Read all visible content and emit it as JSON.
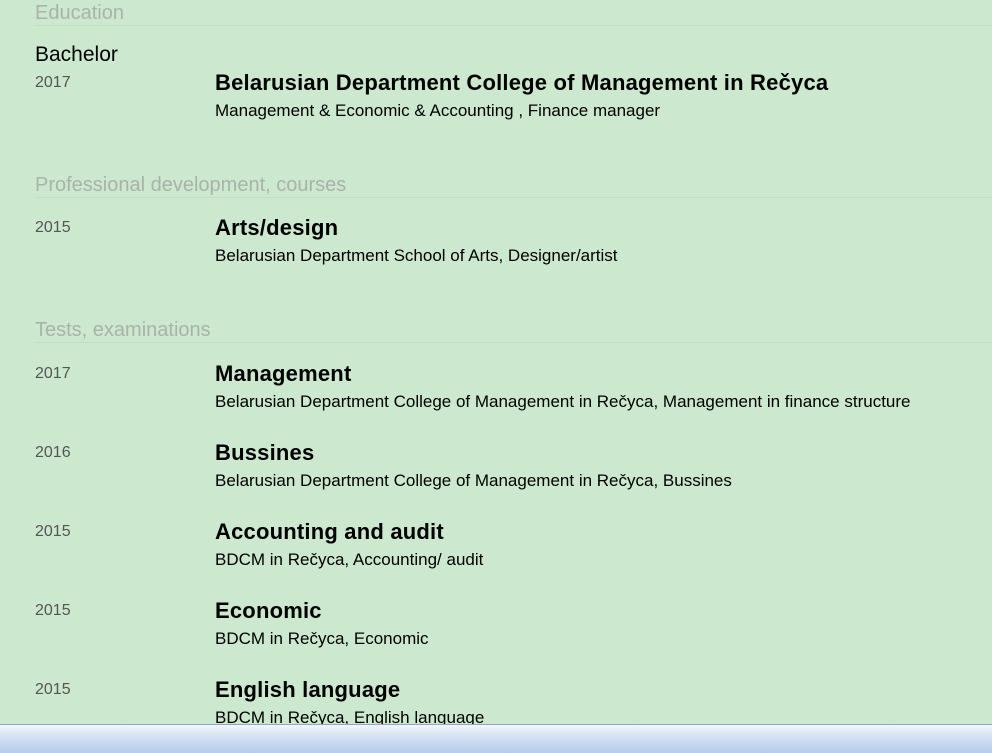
{
  "education": {
    "title": "Education",
    "degree": "Bachelor",
    "entries": [
      {
        "year": "2017",
        "title": "Belarusian Department College of Management in Rečyca",
        "desc": "Management & Economic & Accounting , Finance manager"
      }
    ]
  },
  "courses": {
    "title": "Professional development, courses",
    "entries": [
      {
        "year": "2015",
        "title": "Arts/design",
        "desc": "Belarusian Department School of Arts, Designer/artist"
      }
    ]
  },
  "tests": {
    "title": "Tests, examinations",
    "entries": [
      {
        "year": "2017",
        "title": "Management",
        "desc": "Belarusian Department College of Management in Rečyca, Management in finance structure"
      },
      {
        "year": "2016",
        "title": "Bussines",
        "desc": "Belarusian Department College of Management in Rečyca, Bussines"
      },
      {
        "year": "2015",
        "title": "Accounting and audit",
        "desc": "BDCM in Rečyca, Accounting/ audit"
      },
      {
        "year": "2015",
        "title": "Economic",
        "desc": "BDCM in Rečyca, Economic"
      },
      {
        "year": "2015",
        "title": "English language",
        "desc": "BDCM in Rečyca, English language"
      }
    ]
  }
}
